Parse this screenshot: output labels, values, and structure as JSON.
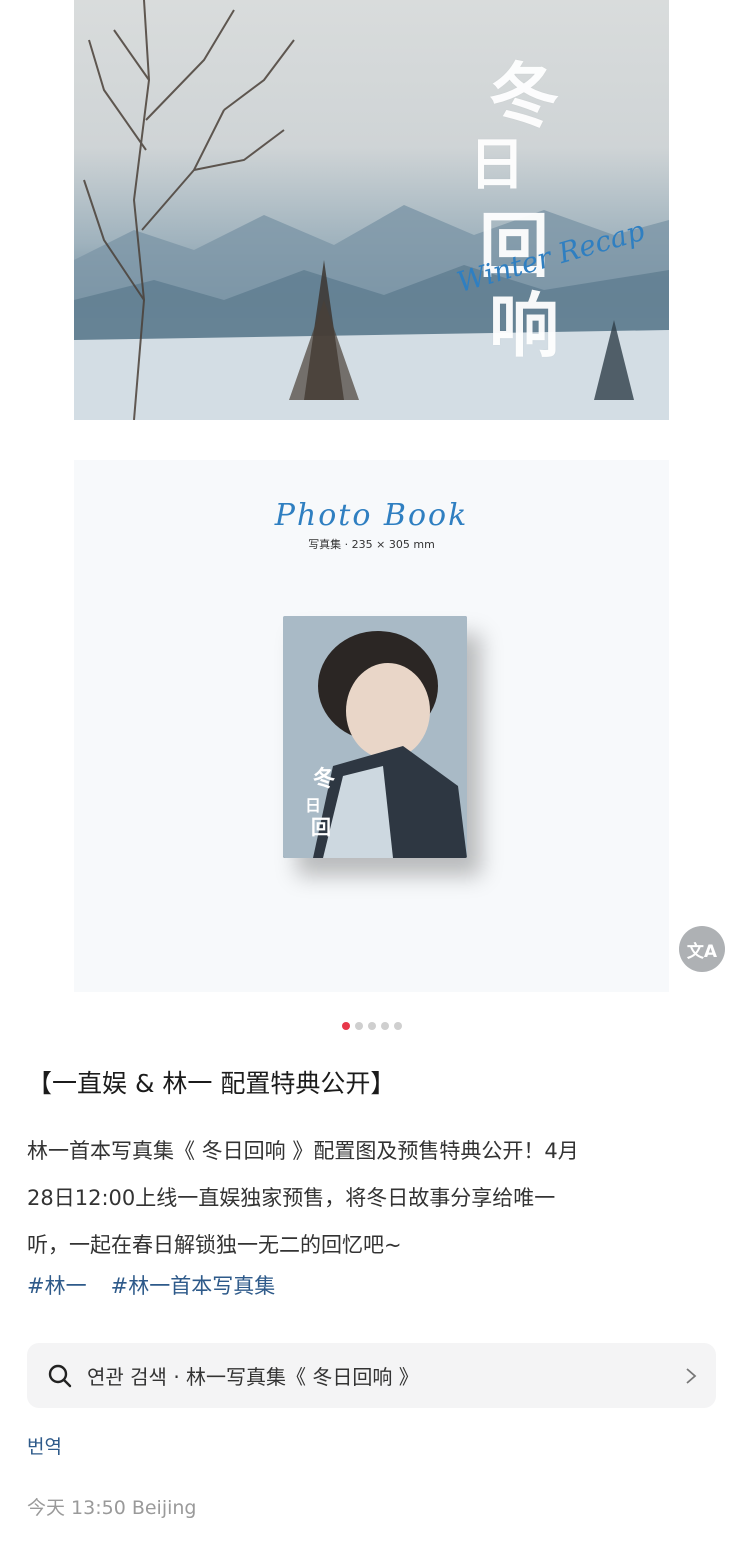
{
  "banner": {
    "calligraphy_chars": [
      "冬",
      "日",
      "回",
      "响"
    ],
    "script_text": "Winter Recap"
  },
  "product": {
    "title": "Photo Book",
    "subtitle": "写真集 · 235 × 305 mm"
  },
  "translate_button": {
    "icon": "translate-icon",
    "glyph": "文A"
  },
  "carousel": {
    "total": 5,
    "active_index": 0
  },
  "post": {
    "title": "【一直娱 & 林一 配置特典公开】",
    "body_lines": [
      "林一首本写真集《 冬日回响 》配置图及预售特典公开！4月",
      "28日12:00上线一直娱独家预售，将冬日故事分享给唯一",
      "听，一起在春日解锁独一无二的回忆吧~"
    ],
    "tags": [
      "#林一",
      "#林一首本写真集"
    ]
  },
  "related_search": {
    "label": "연관 검색 · 林一写真集《 冬日回响 》"
  },
  "translate_link": "번역",
  "timestamp": "今天 13:50 Beijing",
  "colors": {
    "accent_dot": "#e8374a",
    "tag_link": "#2e5a8a",
    "script_blue": "#2f7fc1"
  }
}
